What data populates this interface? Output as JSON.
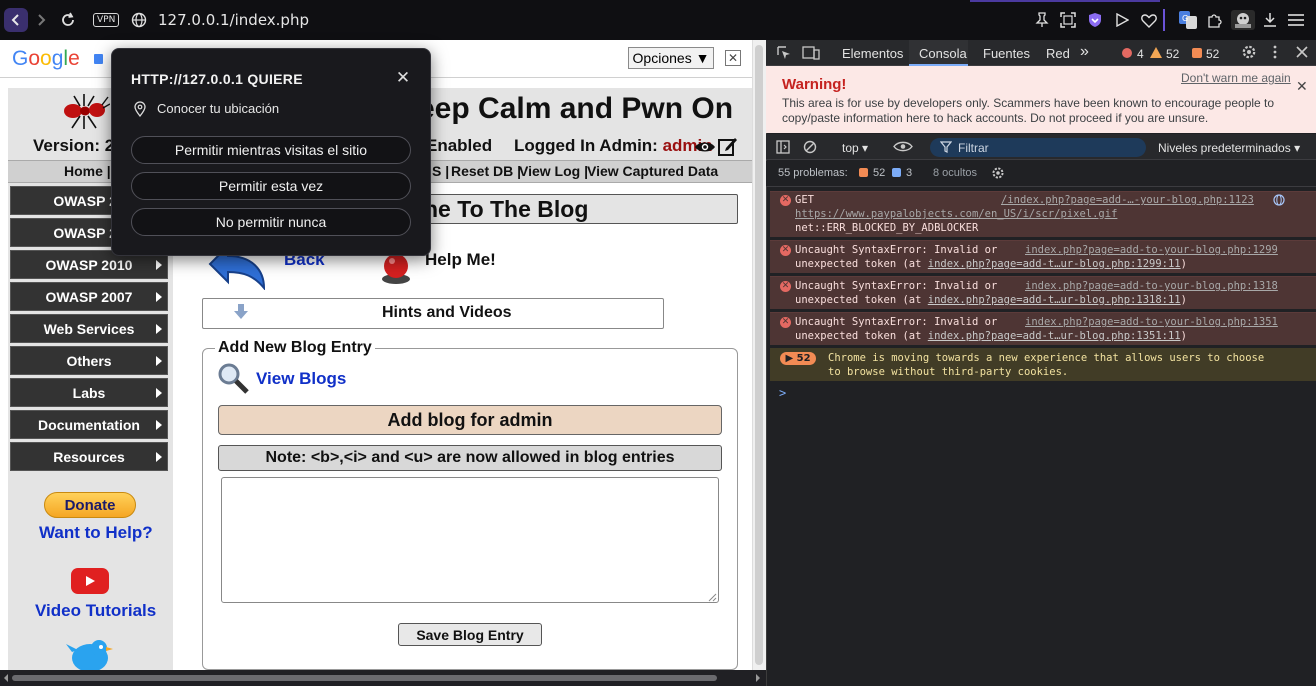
{
  "browser": {
    "address": "127.0.0.1/index.php",
    "vpn_label": "VPN",
    "accent_color": "#6b53d8"
  },
  "google_translate": {
    "logo_text": "Google",
    "options_label": "Opciones ▼",
    "close_label": "✕"
  },
  "site": {
    "title": "eep Calm and Pwn On",
    "version": "Version: 2.",
    "enabled": "Enabled",
    "logged_prefix": "Logged In Admin: ",
    "logged_user": "admin",
    "top_links": {
      "home": "Home |",
      "s": "S |",
      "reset_db": "Reset DB |",
      "view_log": "View Log |",
      "view_captured": "View Captured Data"
    },
    "sidebar": [
      {
        "label": "OWASP 20"
      },
      {
        "label": "OWASP 20"
      },
      {
        "label": "OWASP 2010"
      },
      {
        "label": "OWASP 2007"
      },
      {
        "label": "Web Services"
      },
      {
        "label": "Others"
      },
      {
        "label": "Labs"
      },
      {
        "label": "Documentation"
      },
      {
        "label": "Resources"
      }
    ],
    "donate_label": "Donate",
    "want_help": "Want to Help?",
    "video_tutorials": "Video Tutorials"
  },
  "blog": {
    "title": "ne To The Blog",
    "back": "Back",
    "help": "Help Me!",
    "hints": "Hints and Videos",
    "legend": "Add New Blog Entry",
    "view_blogs": "View Blogs",
    "add_for": "Add blog for admin",
    "note": "Note: <b>,<i> and <u> are now allowed in blog entries",
    "textarea_value": "",
    "save": "Save Blog Entry"
  },
  "permission": {
    "title": "HTTP://127.0.0.1 QUIERE",
    "location": "Conocer tu ubicación",
    "allow_visit": "Permitir mientras visitas el sitio",
    "allow_once": "Permitir esta vez",
    "never": "No permitir nunca"
  },
  "devtools": {
    "tabs": {
      "elements": "Elementos",
      "console": "Consola",
      "sources": "Fuentes",
      "network": "Red",
      "more": "»"
    },
    "counts": {
      "errors": "4",
      "warnings": "52",
      "issues": "52"
    },
    "warning": {
      "title": "Warning!",
      "dont_warn": "Don't warn me again",
      "text": "This area is for use by developers only. Scammers have been known to encourage people to copy/paste information here to hack accounts. Do not proceed if you are unsure."
    },
    "toolbar": {
      "context": "top ▾",
      "filter": "Filtrar",
      "levels": "Niveles predeterminados ▾"
    },
    "issues_bar": {
      "label": "55 problemas:",
      "warn_count": "52",
      "info_count": "3",
      "hidden": "8 ocultos"
    },
    "messages": {
      "m1_line1": "GET",
      "m1_src": "/index.php?page=add-…-your-blog.php:1123",
      "m1_url": "https://www.paypalobjects.com/en_US/i/scr/pixel.gif",
      "m1_line3": "net::ERR_BLOCKED_BY_ADBLOCKER",
      "m2_line1": "Uncaught SyntaxError: Invalid or",
      "m2_src": "index.php?page=add-to-your-blog.php:1299",
      "m2_line2_pre": "unexpected token (at ",
      "m2_line2_link": "index.php?page=add-t…ur-blog.php:1299:11",
      "m3_line1": "Uncaught SyntaxError: Invalid or",
      "m3_src": "index.php?page=add-to-your-blog.php:1318",
      "m3_line2_pre": "unexpected token (at ",
      "m3_line2_link": "index.php?page=add-t…ur-blog.php:1318:11",
      "m4_line1": "Uncaught SyntaxError: Invalid or",
      "m4_src": "index.php?page=add-to-your-blog.php:1351",
      "m4_line2_pre": "unexpected token (at ",
      "m4_line2_link": "index.php?page=add-t…ur-blog.php:1351:11",
      "close_paren": ")",
      "badge": "▶ 52",
      "m5_line1": "Chrome is moving towards a new experience that allows users to choose",
      "m5_line2": "to browse without third-party cookies."
    },
    "prompt": ">"
  }
}
